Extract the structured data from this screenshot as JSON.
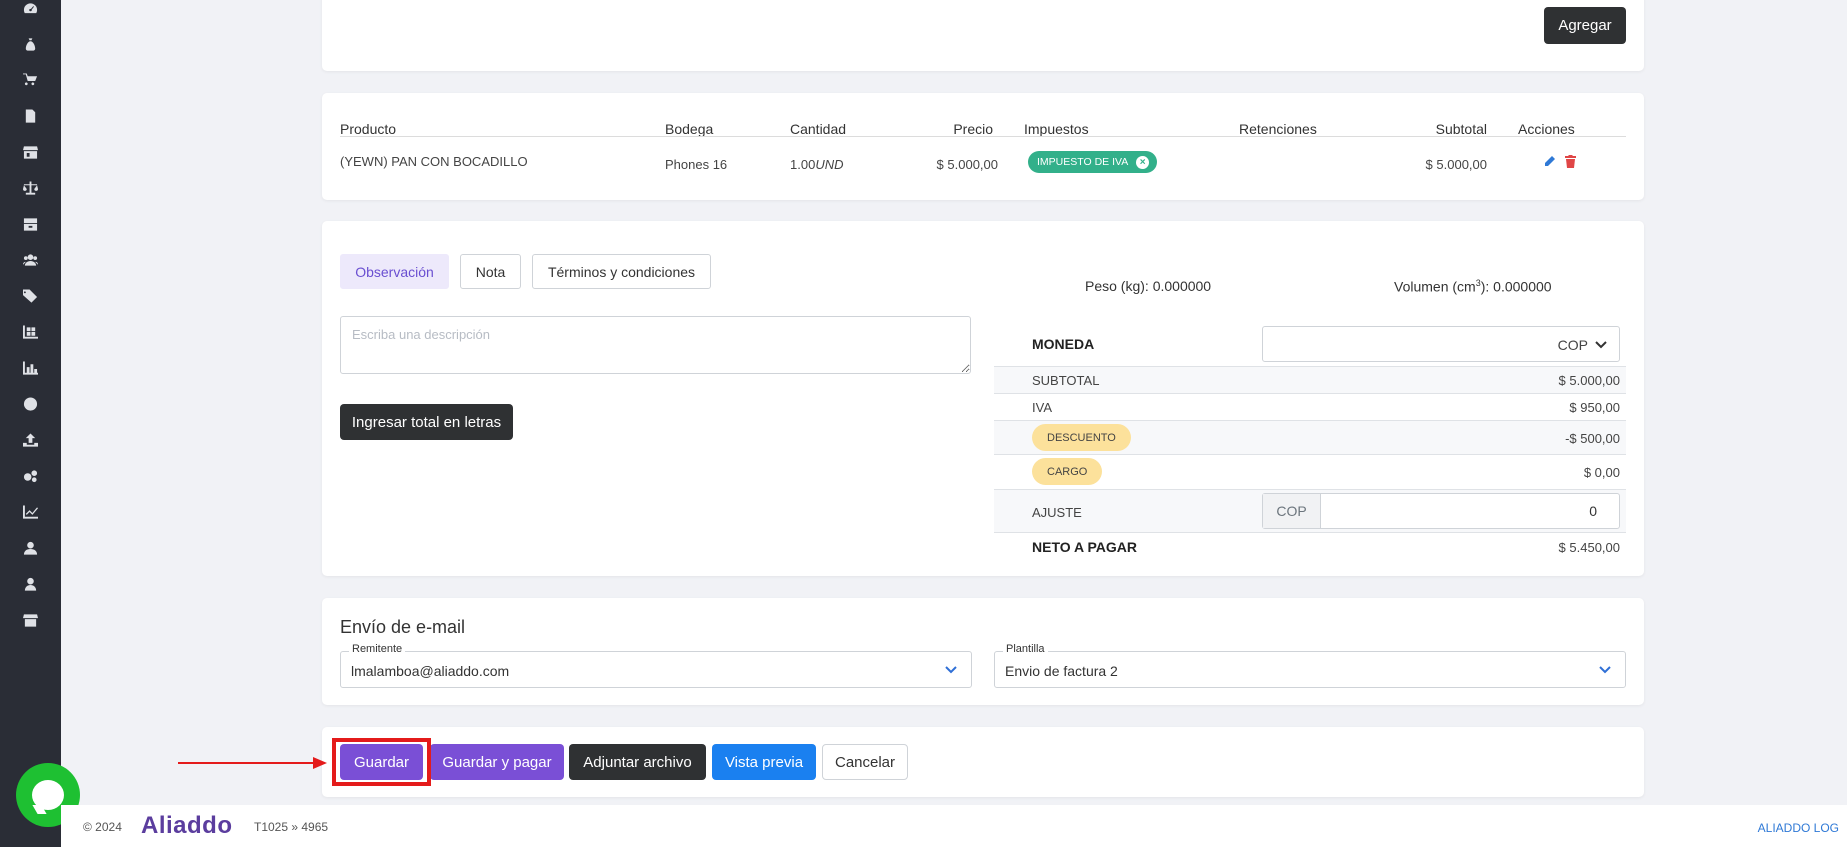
{
  "sidebar": {
    "icons": [
      "dashboard-icon",
      "money-bag-icon",
      "cart-icon",
      "document-icon",
      "store-icon",
      "scale-icon",
      "inventory-icon",
      "users-icon",
      "tags-icon",
      "warehouse-icon",
      "chart-bar-icon",
      "coin-icon",
      "upload-icon",
      "settings-icon",
      "analytics-icon",
      "user-tie-icon",
      "user-icon",
      "shop-icon"
    ]
  },
  "top": {
    "add_label": "Agregar"
  },
  "products": {
    "headers": {
      "product": "Producto",
      "warehouse": "Bodega",
      "quantity": "Cantidad",
      "price": "Precio",
      "taxes": "Impuestos",
      "retentions": "Retenciones",
      "subtotal": "Subtotal",
      "actions": "Acciones"
    },
    "row": {
      "product": "(YEWN) PAN CON BOCADILLO",
      "warehouse": "Phones 16",
      "quantity": "1.00",
      "unit": "UND",
      "price": "$ 5.000,00",
      "tax": "IMPUESTO DE IVA",
      "subtotal": "$ 5.000,00"
    }
  },
  "notes": {
    "tabs": [
      "Observación",
      "Nota",
      "Términos y condiciones"
    ],
    "description_placeholder": "Escriba una descripción",
    "letters_button": "Ingresar total en letras"
  },
  "summary": {
    "weight": "Peso (kg): 0.000000",
    "volume_prefix": "Volumen (cm",
    "volume_exp": "3",
    "volume_suffix": "): 0.000000",
    "currency_label": "MONEDA",
    "currency_value": "COP",
    "subtotal_label": "SUBTOTAL",
    "subtotal_value": "$ 5.000,00",
    "iva_label": "IVA",
    "iva_value": "$ 950,00",
    "discount_label": "DESCUENTO",
    "discount_value": "-$ 500,00",
    "charge_label": "CARGO",
    "charge_value": "$ 0,00",
    "adjust_label": "AJUSTE",
    "adjust_currency": "COP",
    "adjust_value": "0",
    "net_label": "NETO A PAGAR",
    "net_value": "$ 5.450,00"
  },
  "email": {
    "title": "Envío de e-mail",
    "sender_label": "Remitente",
    "sender_value": "lmalamboa@aliaddo.com",
    "template_label": "Plantilla",
    "template_value": "Envio de factura 2"
  },
  "actions": {
    "save": "Guardar",
    "save_pay": "Guardar y pagar",
    "attach": "Adjuntar archivo",
    "preview": "Vista previa",
    "cancel": "Cancelar"
  },
  "footer": {
    "copyright": "© 2024",
    "brand": "Aliaddo",
    "version": "T1025 » 4965",
    "log_link": "ALIADDO LOG"
  },
  "colors": {
    "sidebar": "#2a2d36",
    "primary_purple": "#7a4fd6",
    "blue": "#1a80f0",
    "dark_button": "#2f3133",
    "tax_green": "#32b08a",
    "pill_yellow": "#fce19b",
    "highlight_red": "#e41b1b",
    "chat_green": "#1ec032"
  }
}
